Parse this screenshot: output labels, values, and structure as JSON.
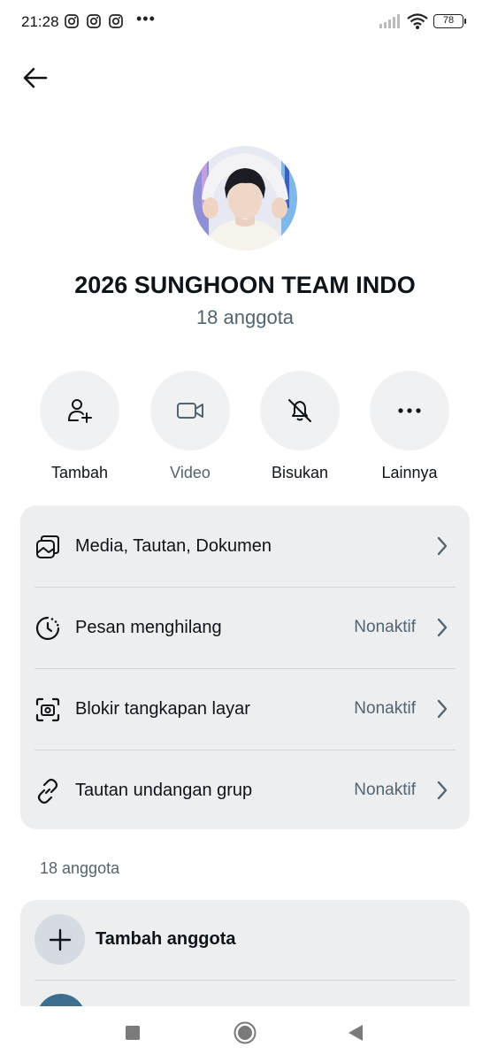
{
  "status_bar": {
    "time": "21:28",
    "notification_icons": [
      "instagram-icon",
      "instagram-icon",
      "instagram-icon"
    ],
    "more": "•••",
    "battery": "78"
  },
  "header": {
    "back_icon": "arrow-left-icon"
  },
  "group": {
    "name": "2026 SUNGHOON TEAM INDO",
    "member_count": "18 anggota"
  },
  "actions": [
    {
      "label": "Tambah",
      "icon": "add-person-icon"
    },
    {
      "label": "Video",
      "icon": "video-camera-icon"
    },
    {
      "label": "Bisukan",
      "icon": "bell-off-icon"
    },
    {
      "label": "Lainnya",
      "icon": "more-horizontal-icon"
    }
  ],
  "settings": [
    {
      "label": "Media, Tautan, Dokumen",
      "value": "",
      "icon": "media-icon"
    },
    {
      "label": "Pesan menghilang",
      "value": "Nonaktif",
      "icon": "timer-icon"
    },
    {
      "label": "Blokir tangkapan layar",
      "value": "Nonaktif",
      "icon": "screenshot-block-icon"
    },
    {
      "label": "Tautan undangan grup",
      "value": "Nonaktif",
      "icon": "link-icon"
    }
  ],
  "members_section": {
    "label": "18 anggota",
    "add_member_label": "Tambah anggota"
  },
  "colors": {
    "text_primary": "#0f1419",
    "text_secondary": "#536471",
    "card_bg": "#eceef0",
    "action_bg": "#eff1f3"
  }
}
